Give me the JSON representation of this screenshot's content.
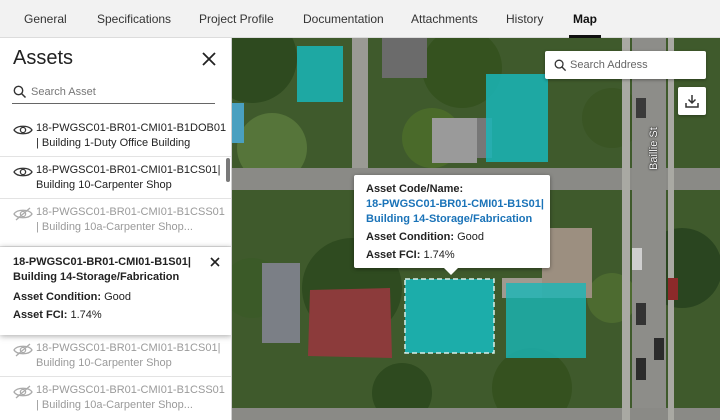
{
  "tabs": [
    {
      "label": "General",
      "active": false
    },
    {
      "label": "Specifications",
      "active": false
    },
    {
      "label": "Project Profile",
      "active": false
    },
    {
      "label": "Documentation",
      "active": false
    },
    {
      "label": "Attachments",
      "active": false
    },
    {
      "label": "History",
      "active": false
    },
    {
      "label": "Map",
      "active": true
    }
  ],
  "sidebar": {
    "title": "Assets",
    "search_placeholder": "Search Asset",
    "items": [
      {
        "line1": "18-PWGSC01-BR01-CMI01-B1DOB01",
        "line2": "| Building 1-Duty Office Building",
        "visible": true
      },
      {
        "line1": "18-PWGSC01-BR01-CMI01-B1CS01|",
        "line2": "Building 10-Carpenter Shop",
        "visible": true
      },
      {
        "line1": "18-PWGSC01-BR01-CMI01-B1CSS01",
        "line2": "| Building 10a-Carpenter Shop...",
        "visible": false
      },
      {
        "line1": "18-PWGSC01-BR01-CMI01-B1CS01|",
        "line2": "Building 10-Carpenter Shop",
        "visible": false
      },
      {
        "line1": "18-PWGSC01-BR01-CMI01-B1CSS01",
        "line2": "| Building 10a-Carpenter Shop...",
        "visible": false
      }
    ],
    "selected": {
      "line1": "18-PWGSC01-BR01-CMI01-B1S01|",
      "line2": "Building 14-Storage/Fabrication",
      "condition_label": "Asset Condition:",
      "condition_value": "Good",
      "fci_label": "Asset FCI:",
      "fci_value": "1.74%"
    }
  },
  "map": {
    "address_placeholder": "Search Address",
    "street_label": "Baillie St",
    "popup": {
      "code_label": "Asset Code/Name:",
      "code_line1": "18-PWGSC01-BR01-CMI01-B1S01|",
      "code_line2": "Building 14-Storage/Fabrication",
      "condition_label": "Asset Condition:",
      "condition_value": "Good",
      "fci_label": "Asset FCI:",
      "fci_value": "1.74%"
    },
    "colors": {
      "asset_fill": "#19b6b8",
      "link": "#1a73b8"
    }
  }
}
